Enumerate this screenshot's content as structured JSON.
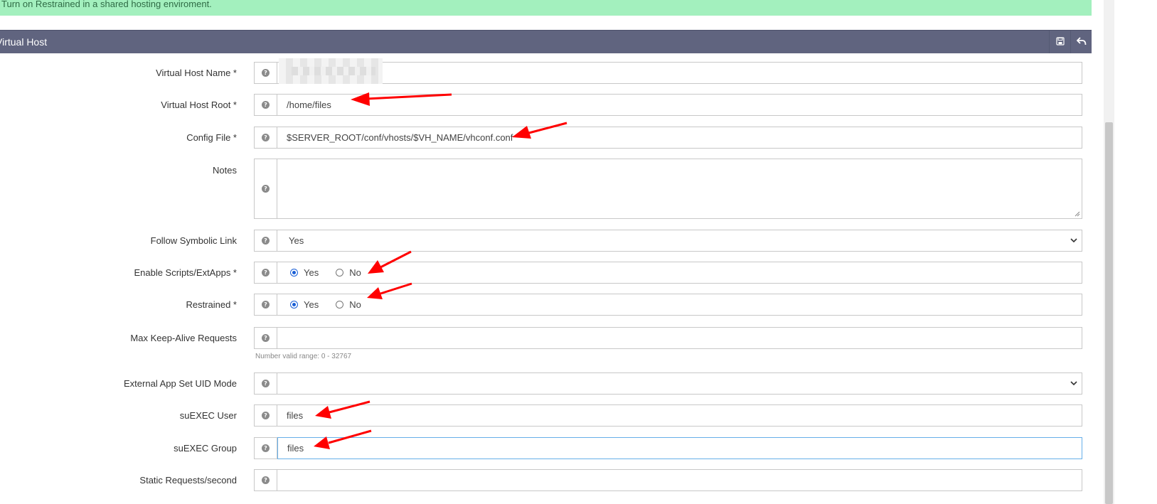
{
  "notice": {
    "text": "Turn on Restrained in a shared hosting enviroment."
  },
  "panel": {
    "title": "Virtual Host",
    "save_icon": "save-icon",
    "back_icon": "undo-arrow-icon"
  },
  "form": {
    "vhost_name": {
      "label": "Virtual Host Name *",
      "value": ""
    },
    "vhost_root": {
      "label": "Virtual Host Root *",
      "value": "/home/files"
    },
    "config_file": {
      "label": "Config File *",
      "value": "$SERVER_ROOT/conf/vhosts/$VH_NAME/vhconf.conf"
    },
    "notes": {
      "label": "Notes",
      "value": ""
    },
    "follow_symlink": {
      "label": "Follow Symbolic Link",
      "value": "Yes"
    },
    "enable_scripts": {
      "label": "Enable Scripts/ExtApps *",
      "yes": "Yes",
      "no": "No",
      "selected": "Yes"
    },
    "restrained": {
      "label": "Restrained *",
      "yes": "Yes",
      "no": "No",
      "selected": "Yes"
    },
    "max_keepalive": {
      "label": "Max Keep-Alive Requests",
      "value": "",
      "hint": "Number valid range: 0 - 32767"
    },
    "ext_app_uid_mode": {
      "label": "External App Set UID Mode",
      "value": ""
    },
    "suexec_user": {
      "label": "suEXEC User",
      "value": "files"
    },
    "suexec_group": {
      "label": "suEXEC Group",
      "value": "files"
    },
    "static_requests": {
      "label": "Static Requests/second",
      "value": ""
    }
  },
  "colors": {
    "notice_bg": "#a3f0be",
    "header_bg": "#60647f",
    "annotation": "#ff0000",
    "radio_accent": "#1a5fd6"
  }
}
